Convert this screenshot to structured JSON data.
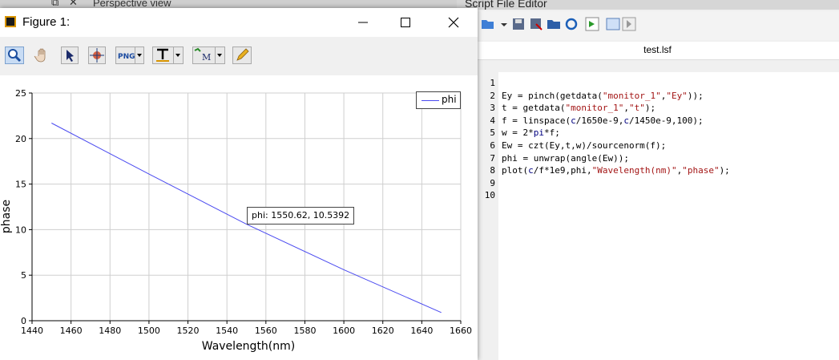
{
  "editor": {
    "title": "Script File Editor",
    "tab": "test.lsf",
    "line_numbers": [
      "1",
      "2",
      "3",
      "4",
      "5",
      "6",
      "7",
      "8",
      "9",
      "10"
    ],
    "code": [
      "",
      "Ey = pinch(getdata(\"monitor_1\",\"Ey\"));",
      "t = getdata(\"monitor_1\",\"t\");",
      "f = linspace(c/1650e-9,c/1450e-9,100);",
      "w = 2*pi*f;",
      "Ew = czt(Ey,t,w)/sourcenorm(f);",
      "phi = unwrap(angle(Ew));",
      "plot(c/f*1e9,phi,\"Wavelength(nm)\",\"phase\");",
      "",
      ""
    ]
  },
  "perspective": {
    "title": "Perspective view"
  },
  "figure": {
    "title": "Figure 1:",
    "tooltip": "phi: 1550.62, 10.5392",
    "toolbar_icons": [
      "zoom-icon",
      "pan-hand-icon",
      "select-arrow-icon",
      "data-cursor-icon",
      "png-export-icon",
      "text-insert-icon",
      "marker-insert-icon",
      "pencil-edit-icon"
    ]
  },
  "chart_data": {
    "type": "line",
    "title": "",
    "xlabel": "Wavelength(nm)",
    "ylabel": "phase",
    "xlim": [
      1440,
      1660
    ],
    "ylim": [
      0,
      25
    ],
    "xticks": [
      "1440",
      "1460",
      "1480",
      "1500",
      "1520",
      "1540",
      "1560",
      "1580",
      "1600",
      "1620",
      "1640",
      "1660"
    ],
    "yticks": [
      "0",
      "5",
      "10",
      "15",
      "20",
      "25"
    ],
    "grid": true,
    "legend": "top-right",
    "series": [
      {
        "name": "phi",
        "color": "#4a4af0",
        "x": [
          1450,
          1500,
          1550,
          1600,
          1650
        ],
        "y": [
          21.7,
          16.1,
          10.6,
          5.6,
          0.9
        ]
      }
    ]
  }
}
